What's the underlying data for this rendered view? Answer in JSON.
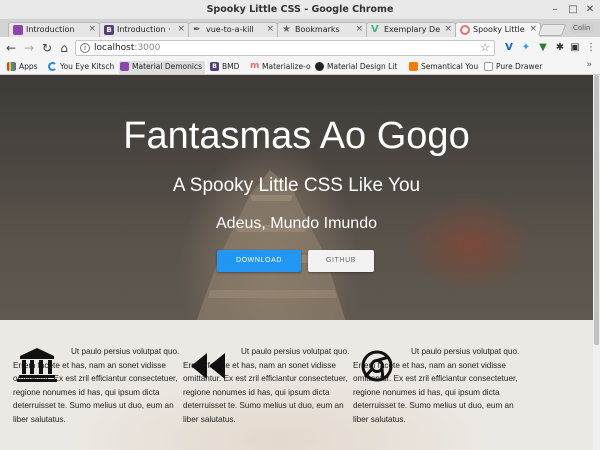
{
  "window": {
    "title": "Spooky Little CSS - Google Chrome"
  },
  "tabs": [
    {
      "label": "Introduction",
      "icon": "material-icon",
      "color": "#8e44ad"
    },
    {
      "label": "Introduction ·",
      "icon": "bootstrap-icon",
      "color": "#563d7c"
    },
    {
      "label": "vue-to-a-kill",
      "icon": "pen-icon",
      "color": "#555555"
    },
    {
      "label": "Bookmarks",
      "icon": "star-icon",
      "color": "#666666"
    },
    {
      "label": "Exemplary De",
      "icon": "vue-icon",
      "color": "#41b883"
    },
    {
      "label": "Spooky Little",
      "icon": "spooky-icon",
      "color": "#e57373"
    }
  ],
  "profile": "Colin",
  "toolbar": {
    "url_host": "localhost",
    "url_port": ":3000"
  },
  "bookmarks": [
    {
      "label": "Apps",
      "icon": "apps-icon",
      "color": "#e53935"
    },
    {
      "label": "You Eye Kitsch",
      "icon": "refresh-icon",
      "color": "#1e88e5"
    },
    {
      "label": "Material Demonics",
      "icon": "material-icon",
      "color": "#8e44ad"
    },
    {
      "label": "BMD",
      "icon": "bootstrap-icon",
      "color": "#563d7c"
    },
    {
      "label": "Materialize-o",
      "icon": "materialize-icon",
      "color": "#ee6e73"
    },
    {
      "label": "Material Design Lit",
      "icon": "github-icon",
      "color": "#222222"
    },
    {
      "label": "Semantical You",
      "icon": "semantic-icon",
      "color": "#f57c00"
    },
    {
      "label": "Pure Drawer",
      "icon": "page-icon",
      "color": "#999999"
    }
  ],
  "bookmarks_more": "»",
  "hero": {
    "title": "Fantasmas Ao Gogo",
    "subtitle": "A Spooky Little CSS Like You",
    "tagline": "Adeus, Mundo Imundo",
    "download_label": "DOWNLOAD",
    "github_label": "GITHUB"
  },
  "features": [
    {
      "icon": "bank-icon",
      "text": "Ut paulo persius volutpat quo. Errem facete et has, nam an sonet vidisse omittantur. Ex est zril efficiantur consectetuer, regione nonumes id has, qui ipsum dicta deterruisset te. Sumo melius ut duo, eum an liber salutatus."
    },
    {
      "icon": "rewind-icon",
      "text": "Ut paulo persius volutpat quo. Errem facete et has, nam an sonet vidisse omittantur. Ex est zril efficiantur consectetuer, regione nonumes id has, qui ipsum dicta deterruisset te. Sumo melius ut duo, eum an liber salutatus."
    },
    {
      "icon": "chrome-icon",
      "text": "Ut paulo persius volutpat quo. Errem facete et has, nam an sonet vidisse omittantur. Ex est zril efficiantur consectetuer, regione nonumes id has, qui ipsum dicta deterruisset te. Sumo melius ut duo, eum an liber salutatus."
    }
  ]
}
